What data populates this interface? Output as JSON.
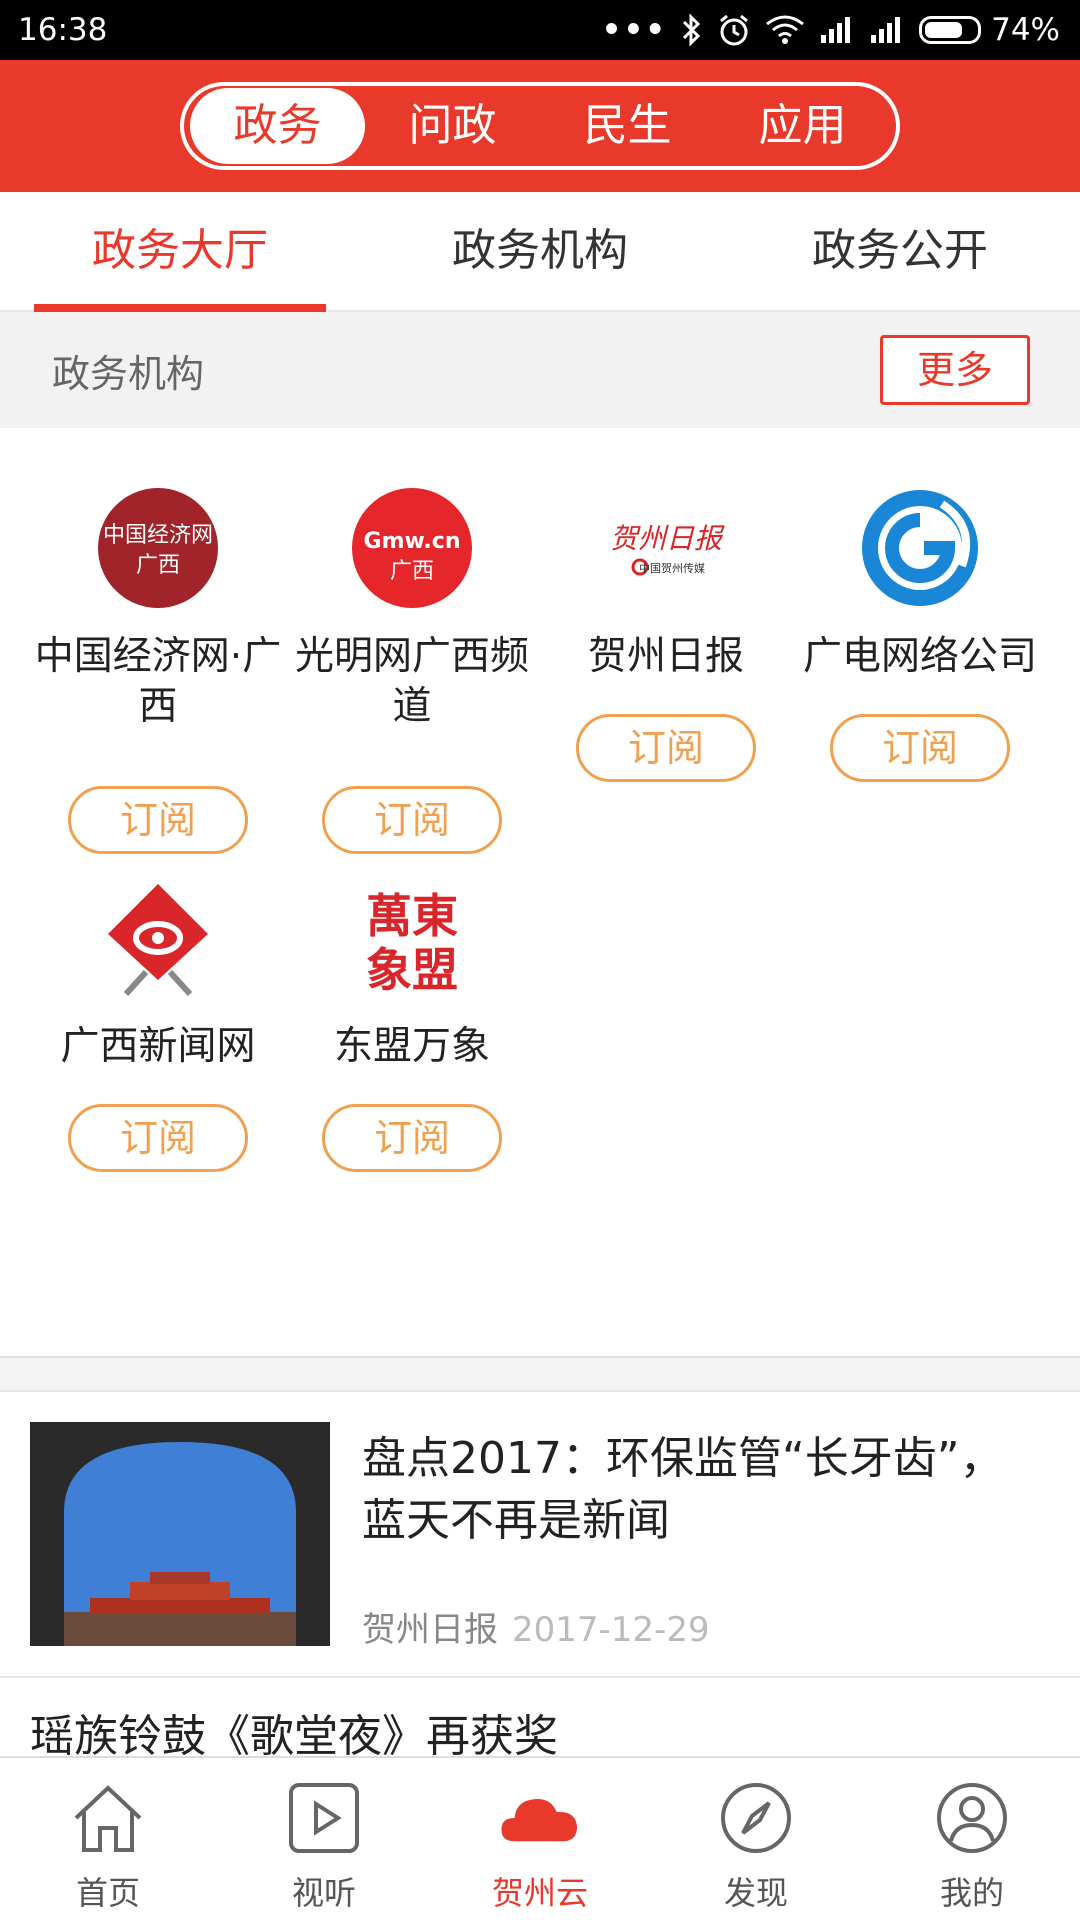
{
  "status_bar": {
    "time": "16:38",
    "dots": "•••",
    "battery": "74%"
  },
  "top_segments": [
    {
      "label": "政务",
      "active": true
    },
    {
      "label": "问政",
      "active": false
    },
    {
      "label": "民生",
      "active": false
    },
    {
      "label": "应用",
      "active": false
    }
  ],
  "sub_tabs": [
    {
      "label": "政务大厅",
      "active": true
    },
    {
      "label": "政务机构",
      "active": false
    },
    {
      "label": "政务公开",
      "active": false
    }
  ],
  "section": {
    "title": "政务机构",
    "more_label": "更多"
  },
  "orgs": [
    {
      "name": "中国经济网·广西",
      "button": "订阅",
      "logo_text_1": "中国经济网",
      "logo_text_2": "广西"
    },
    {
      "name": "光明网广西频道",
      "button": "订阅",
      "logo_text_1": "Gmw.cn",
      "logo_text_2": "广西"
    },
    {
      "name": "贺州日报",
      "button": "订阅",
      "logo_text_1": "贺州日报",
      "logo_text_2": "中国贺州传媒"
    },
    {
      "name": "广电网络公司",
      "button": "订阅"
    },
    {
      "name": "广西新闻网",
      "button": "订阅"
    },
    {
      "name": "东盟万象",
      "button": "订阅",
      "logo_text_1": "萬東",
      "logo_text_2": "象盟"
    }
  ],
  "news": [
    {
      "title": "盘点2017：环保监管“长牙齿”，蓝天不再是新闻",
      "source": "贺州日报",
      "date": "2017-12-29"
    },
    {
      "title": "瑶族铃鼓《歌堂夜》再获奖"
    }
  ],
  "bottom_nav": [
    {
      "label": "首页",
      "icon": "home-icon",
      "active": false
    },
    {
      "label": "视听",
      "icon": "play-icon",
      "active": false
    },
    {
      "label": "贺州云",
      "icon": "cloud-icon",
      "active": true
    },
    {
      "label": "发现",
      "icon": "compass-icon",
      "active": false
    },
    {
      "label": "我的",
      "icon": "user-icon",
      "active": false
    }
  ],
  "colors": {
    "brand_red": "#e8392b",
    "subscribe_orange": "#f0a050"
  }
}
